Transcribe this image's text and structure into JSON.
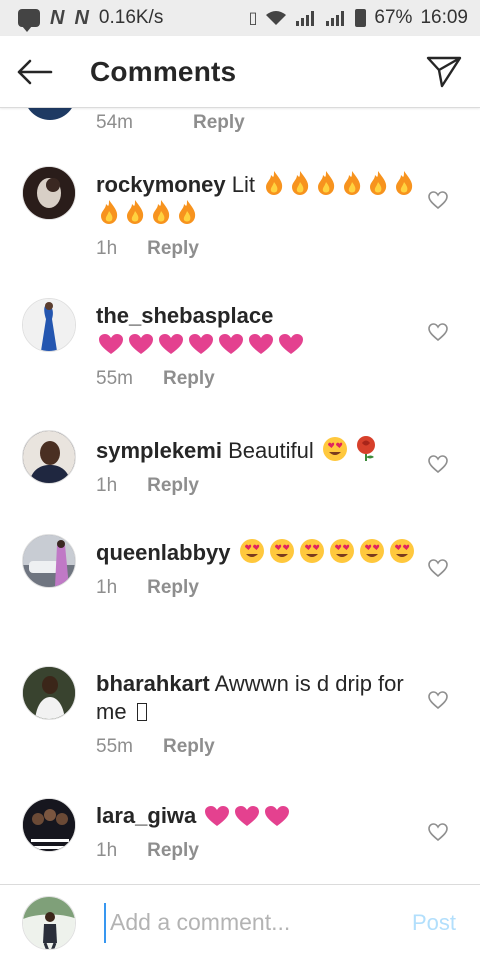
{
  "status_bar": {
    "speed": "0.16K/s",
    "battery_pct": "67%",
    "time": "16:09"
  },
  "header": {
    "title": "Comments",
    "back_icon": "arrow-left-icon",
    "send_icon": "paper-plane-icon"
  },
  "partial_comment": {
    "time": "54m",
    "reply": "Reply"
  },
  "comments": [
    {
      "username": "rockymoney",
      "text": "Lit",
      "emoji": "🔥🔥🔥🔥🔥🔥🔥🔥🔥🔥",
      "time": "1h",
      "reply": "Reply",
      "avatar_color": "#5a3b33"
    },
    {
      "username": "the_shebasplace",
      "text": "",
      "emoji": "💗💗💗💗💗💗💗",
      "time": "55m",
      "reply": "Reply",
      "avatar_color": "#2456b0"
    },
    {
      "username": "symplekemi",
      "text": "Beautiful",
      "emoji": "😍🌹",
      "time": "1h",
      "reply": "Reply",
      "avatar_color": "#2b2b3a"
    },
    {
      "username": "queenlabbyy",
      "text": "",
      "emoji": "😍😍😍😍😍😍",
      "time": "1h",
      "reply": "Reply",
      "avatar_color": "#8a8f99"
    },
    {
      "username": "bharahkart",
      "text": "Awwwn is d drip for me",
      "emoji": "",
      "time": "55m",
      "reply": "Reply",
      "avatar_color": "#3f4a3a"
    },
    {
      "username": "lara_giwa",
      "text": "",
      "emoji": "💗💗💗",
      "time": "1h",
      "reply": "Reply",
      "avatar_color": "#1e1e28"
    }
  ],
  "input": {
    "placeholder": "Add a comment...",
    "post_label": "Post"
  },
  "colors": {
    "link_blue": "#3897f0",
    "post_disabled": "#b2dffc",
    "meta_gray": "#8e8e8e",
    "heart_pink": "#e4418f",
    "fire_orange": "#f7931e"
  }
}
